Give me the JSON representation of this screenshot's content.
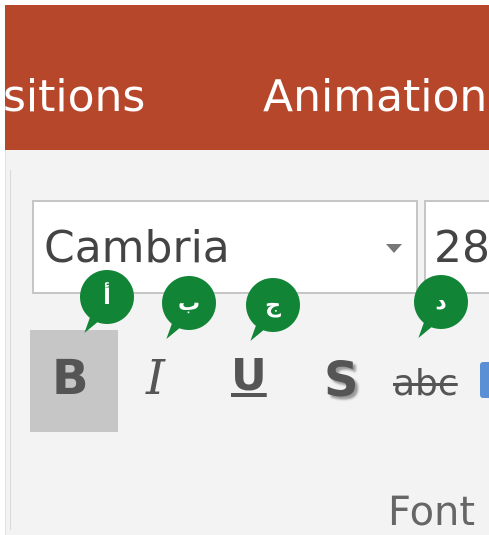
{
  "colors": {
    "ribbon_bar": "#b7472a",
    "badge": "#128436"
  },
  "tabs": [
    {
      "label": "sitions"
    },
    {
      "label": "Animations"
    }
  ],
  "font_group": {
    "font_name": {
      "value": "Cambria"
    },
    "font_size": {
      "value": "28"
    },
    "buttons": [
      {
        "name": "bold",
        "glyph": "B",
        "state": "selected"
      },
      {
        "name": "italic",
        "glyph": "I"
      },
      {
        "name": "underline",
        "glyph": "U"
      },
      {
        "name": "text-shadow",
        "glyph": "S"
      },
      {
        "name": "strikethrough",
        "glyph": "abc"
      }
    ],
    "label": "Font"
  },
  "annotations": [
    "أ",
    "ب",
    "ج",
    "د"
  ]
}
